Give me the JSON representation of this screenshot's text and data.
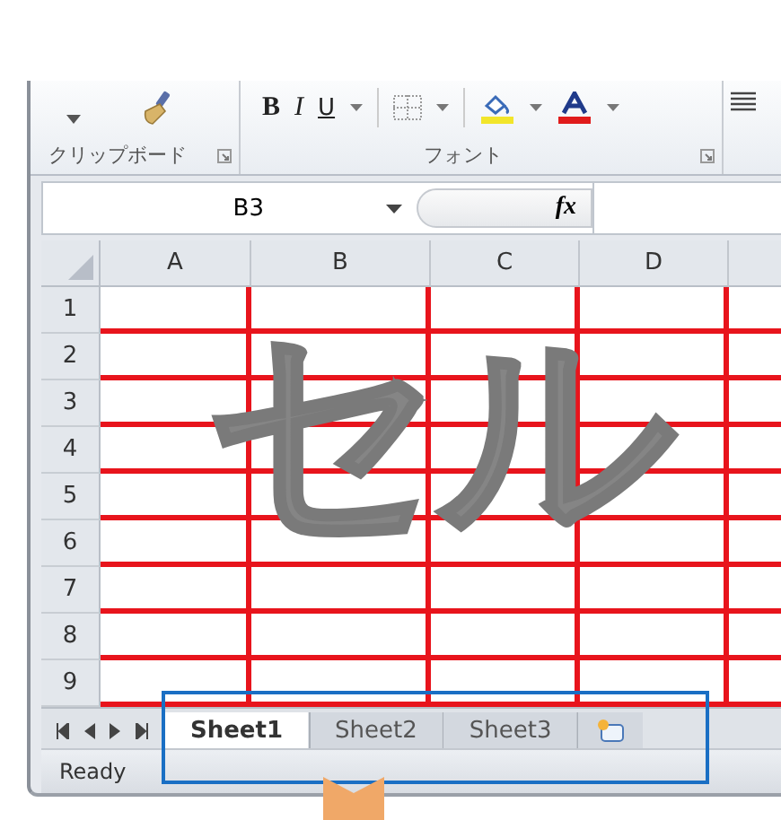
{
  "ribbon": {
    "groups": [
      {
        "kind": "clipboard",
        "label": "クリップボード"
      },
      {
        "kind": "font",
        "label": "フォント",
        "buttons": [
          "B",
          "I",
          "U"
        ]
      }
    ]
  },
  "formula_bar": {
    "name_box": "B3",
    "function_label": "fx"
  },
  "sheet": {
    "columns": [
      "A",
      "B",
      "C",
      "D"
    ],
    "rows": [
      "1",
      "2",
      "3",
      "4",
      "5",
      "6",
      "7",
      "8",
      "9"
    ]
  },
  "overlay_text": "セル",
  "sheet_tabs": [
    {
      "label": "Sheet1",
      "selected": true
    },
    {
      "label": "Sheet2",
      "selected": false
    },
    {
      "label": "Sheet3",
      "selected": false
    }
  ],
  "status_bar": {
    "text": "Ready"
  }
}
